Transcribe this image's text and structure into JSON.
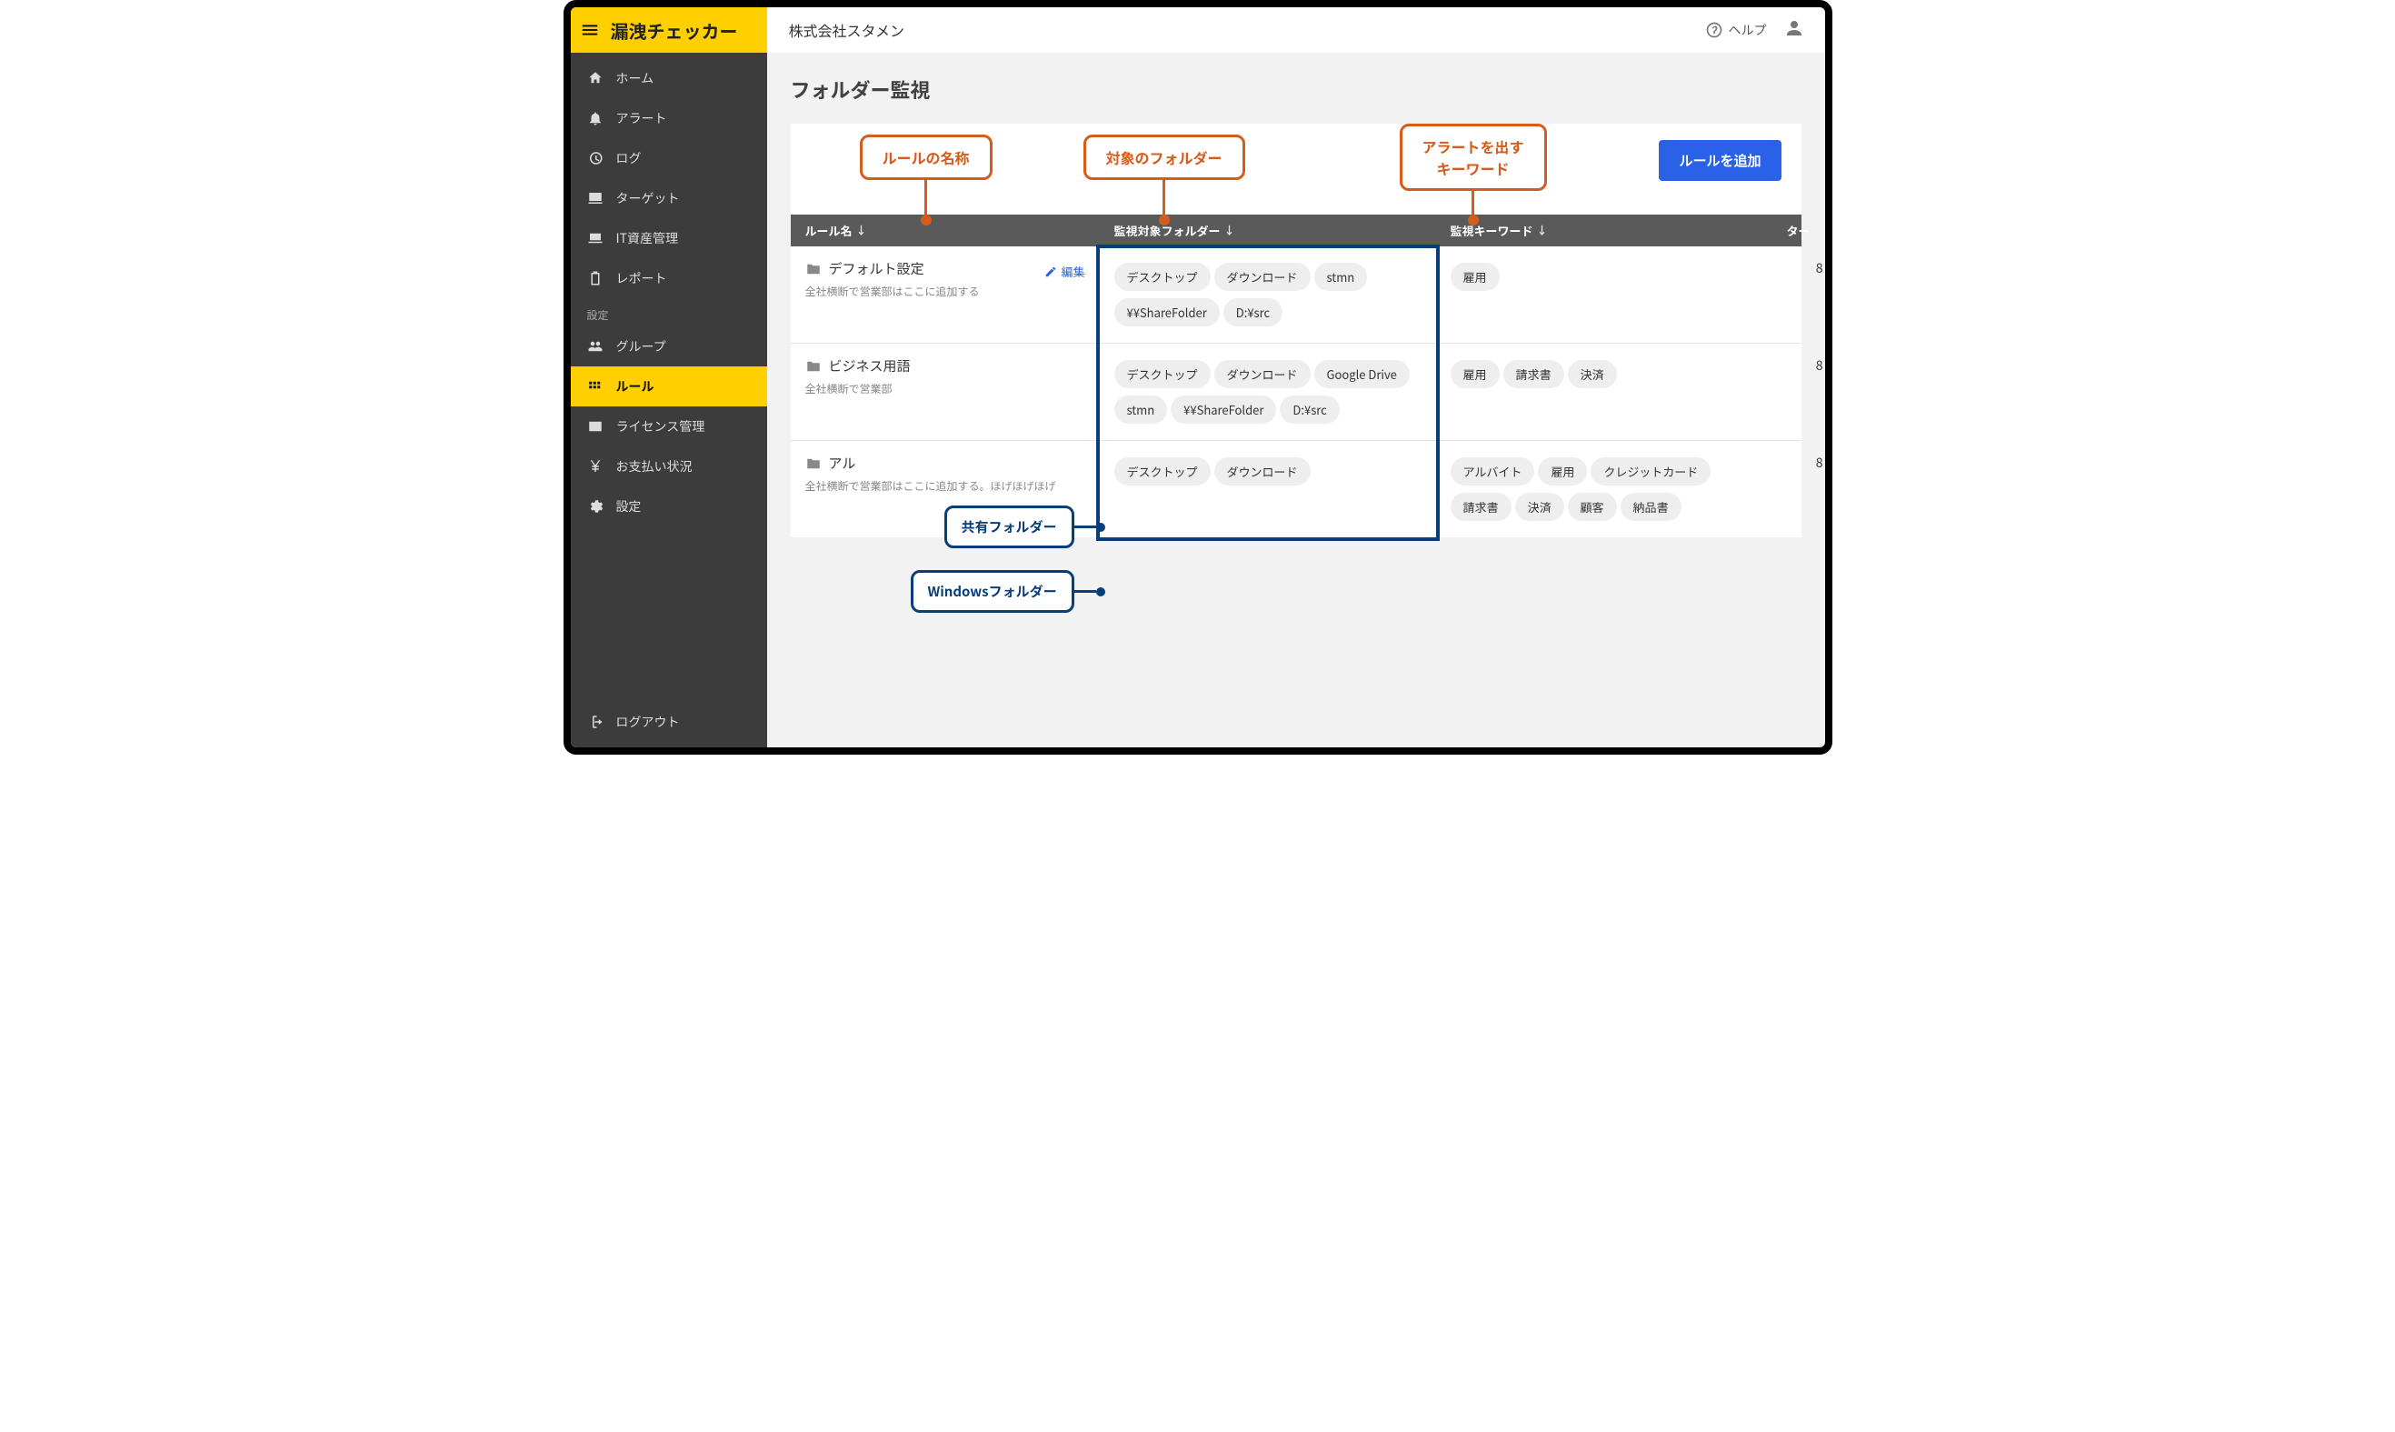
{
  "brand": {
    "name": "漏洩チェッカー"
  },
  "header": {
    "company": "株式会社スタメン",
    "help_label": "ヘルプ"
  },
  "sidebar": {
    "items": [
      {
        "key": "home",
        "label": "ホーム"
      },
      {
        "key": "alert",
        "label": "アラート"
      },
      {
        "key": "log",
        "label": "ログ"
      },
      {
        "key": "target",
        "label": "ターゲット"
      },
      {
        "key": "asset",
        "label": "IT資産管理"
      },
      {
        "key": "report",
        "label": "レポート"
      }
    ],
    "section_label": "設定",
    "settings": [
      {
        "key": "group",
        "label": "グループ"
      },
      {
        "key": "rule",
        "label": "ルール"
      },
      {
        "key": "license",
        "label": "ライセンス管理"
      },
      {
        "key": "payment",
        "label": "お支払い状況"
      },
      {
        "key": "settings",
        "label": "設定"
      }
    ],
    "logout_label": "ログアウト"
  },
  "page": {
    "title": "フォルダー監視",
    "add_button": "ルールを追加"
  },
  "columns": {
    "rule": "ルール名",
    "folder": "監視対象フォルダー",
    "keyword": "監視キーワード",
    "count": "ター"
  },
  "annotations": {
    "a1": "ルールの名称",
    "a2": "対象のフォルダー",
    "a3": "アラートを出す\nキーワード",
    "row2_box": "共有フォルダー",
    "row3_box": "Windowsフォルダー"
  },
  "rows": [
    {
      "name": "デフォルト設定",
      "desc": "全社横断で営業部はここに追加する",
      "show_edit": true,
      "edit_label": "編集",
      "folders": [
        "デスクトップ",
        "ダウンロード",
        "stmn",
        "¥¥ShareFolder",
        "D:¥src"
      ],
      "keywords": [
        "雇用"
      ],
      "count": "8"
    },
    {
      "name": "ビジネス用語",
      "desc": "全社横断で営業部",
      "show_edit": false,
      "folders": [
        "デスクトップ",
        "ダウンロード",
        "Google Drive",
        "stmn",
        "¥¥ShareFolder",
        "D:¥src"
      ],
      "keywords": [
        "雇用",
        "請求書",
        "決済"
      ],
      "count": "8"
    },
    {
      "name": "アル",
      "desc": "全社横断で営業部はここに追加する。ほげほげほげ",
      "show_edit": false,
      "folders": [
        "デスクトップ",
        "ダウンロード"
      ],
      "keywords": [
        "アルバイト",
        "雇用",
        "クレジットカード",
        "請求書",
        "決済",
        "顧客",
        "納品書"
      ],
      "count": "8"
    }
  ]
}
